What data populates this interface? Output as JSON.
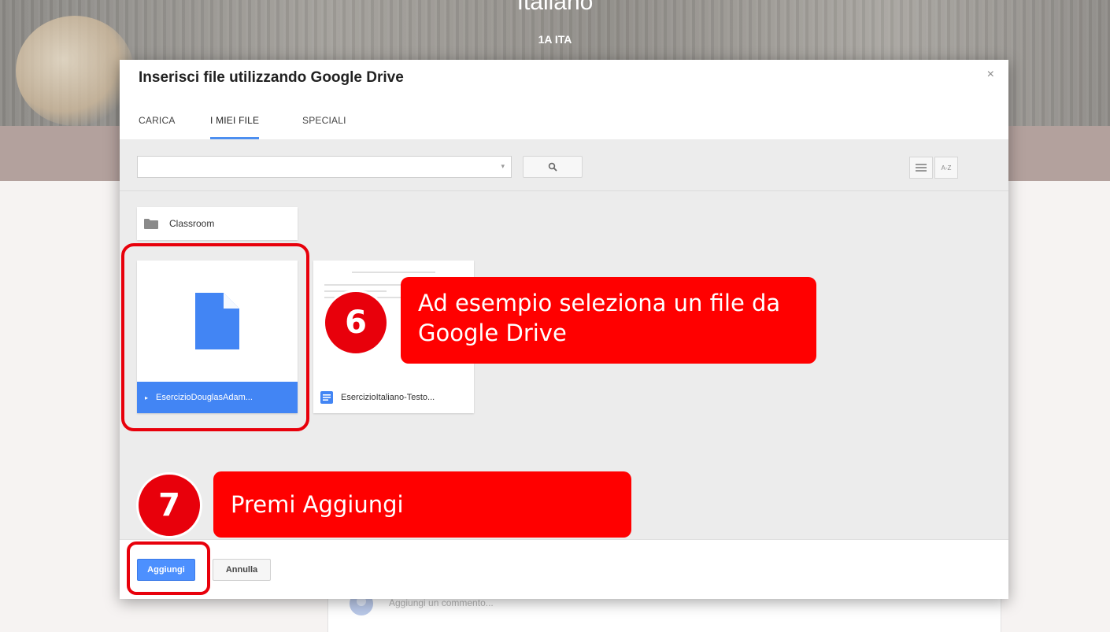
{
  "background": {
    "course_title": "Italiano",
    "course_section": "1A ITA",
    "comment_placeholder": "Aggiungi un commento..."
  },
  "dialog": {
    "title": "Inserisci file utilizzando Google Drive",
    "close_label": "×",
    "tabs": [
      {
        "label": "CARICA",
        "active": false
      },
      {
        "label": "I MIEI FILE",
        "active": true
      },
      {
        "label": "SPECIALI",
        "active": false
      }
    ],
    "search": {
      "value": "",
      "caret": "▾"
    },
    "sort_label": "A-Z",
    "folder": {
      "label": "Classroom",
      "icon": "folder-icon"
    },
    "files": [
      {
        "name": "EsercizioDouglasAdam...",
        "selected": true,
        "icon": "doc-icon"
      },
      {
        "name": "EsercizioItaliano-Testo...",
        "selected": false,
        "icon": "doc-icon"
      }
    ],
    "footer": {
      "primary_label": "Aggiungi",
      "secondary_label": "Annulla"
    }
  },
  "annotations": [
    {
      "number": "6",
      "text": "Ad esempio seleziona un file da Google Drive"
    },
    {
      "number": "7",
      "text": "Premi Aggiungi"
    }
  ],
  "colors": {
    "accent": "#4285f4",
    "annotation_red": "#ff0000"
  }
}
